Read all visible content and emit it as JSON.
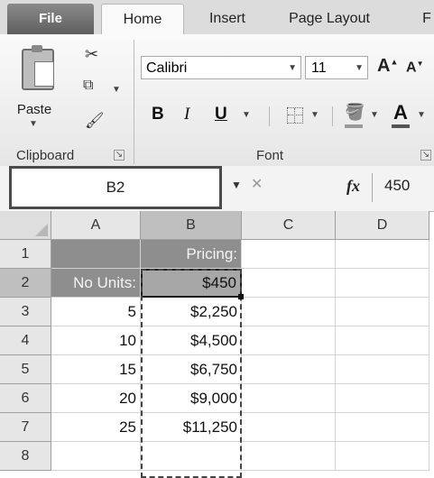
{
  "tabs": {
    "file": "File",
    "home": "Home",
    "insert": "Insert",
    "page_layout": "Page Layout",
    "more": "F"
  },
  "ribbon": {
    "clipboard": {
      "paste_label": "Paste",
      "group_label": "Clipboard",
      "icons": [
        "paste-icon",
        "cut-icon",
        "copy-icon",
        "format-painter-icon"
      ]
    },
    "font": {
      "group_label": "Font",
      "font_name": "Calibri",
      "font_size": "11",
      "bold": "B",
      "italic": "I",
      "underline": "U",
      "grow_font": "A",
      "shrink_font": "A",
      "font_color": "A",
      "icons": [
        "borders-icon",
        "fill-color-icon"
      ]
    }
  },
  "formula_bar": {
    "name_box": "B2",
    "fx_label": "fx",
    "formula": "450"
  },
  "sheet": {
    "columns": [
      "A",
      "B",
      "C",
      "D"
    ],
    "rows": [
      "1",
      "2",
      "3",
      "4",
      "5",
      "6",
      "7",
      "8"
    ],
    "cells": {
      "A1": "",
      "B1": "Pricing:",
      "A2": "No Units:",
      "B2": "$450",
      "A3": "5",
      "B3": "$2,250",
      "A4": "10",
      "B4": "$4,500",
      "A5": "15",
      "B5": "$6,750",
      "A6": "20",
      "B6": "$9,000",
      "A7": "25",
      "B7": "$11,250"
    },
    "active_cell": "B2",
    "copy_range": "B2:B7"
  }
}
